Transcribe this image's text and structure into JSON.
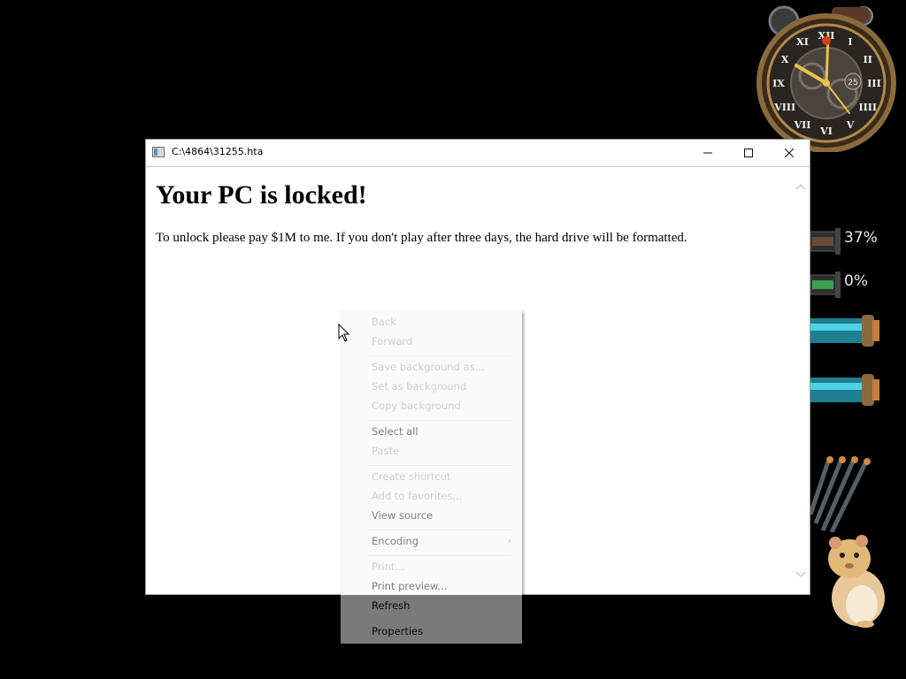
{
  "window": {
    "title": "C:\\4864\\31255.hta",
    "controls": {
      "minimize": "minimize",
      "maximize": "maximize",
      "close": "close"
    }
  },
  "content": {
    "heading": "Your PC is locked!",
    "message": "To unlock please pay $1M to me. If you don't play after three days, the hard drive will be formatted."
  },
  "context_menu": {
    "items": [
      {
        "label": "Back",
        "state": "disabled"
      },
      {
        "label": "Forward",
        "state": "disabled"
      },
      {
        "label": "Save background as...",
        "state": "disabled"
      },
      {
        "label": "Set as background",
        "state": "disabled"
      },
      {
        "label": "Copy background",
        "state": "disabled"
      },
      {
        "label": "Select all",
        "state": "enabled"
      },
      {
        "label": "Paste",
        "state": "disabled"
      },
      {
        "label": "Create shortcut",
        "state": "disabled"
      },
      {
        "label": "Add to favorites...",
        "state": "disabled"
      },
      {
        "label": "View source",
        "state": "enabled"
      },
      {
        "label": "Encoding",
        "state": "enabled",
        "submenu": true
      },
      {
        "label": "Print...",
        "state": "disabled"
      },
      {
        "label": "Print preview...",
        "state": "disabled"
      },
      {
        "label": "Refresh",
        "state": "enabled"
      },
      {
        "label": "Properties",
        "state": "enabled"
      }
    ]
  },
  "gadgets": {
    "clock": {
      "day_number": "25",
      "numerals": [
        "XII",
        "I",
        "II",
        "III",
        "IIII",
        "V",
        "VI",
        "VII",
        "VIII",
        "IX",
        "X",
        "XI"
      ]
    },
    "cpu_meter": {
      "value": "37%"
    },
    "ram_meter": {
      "value": "0%"
    }
  },
  "colors": {
    "desktop_background": "#000000",
    "window_background": "#ffffff",
    "menu_background": "#fafafa"
  },
  "icons": {
    "app": "hta-app-icon",
    "cursor": "arrow-cursor-icon"
  }
}
